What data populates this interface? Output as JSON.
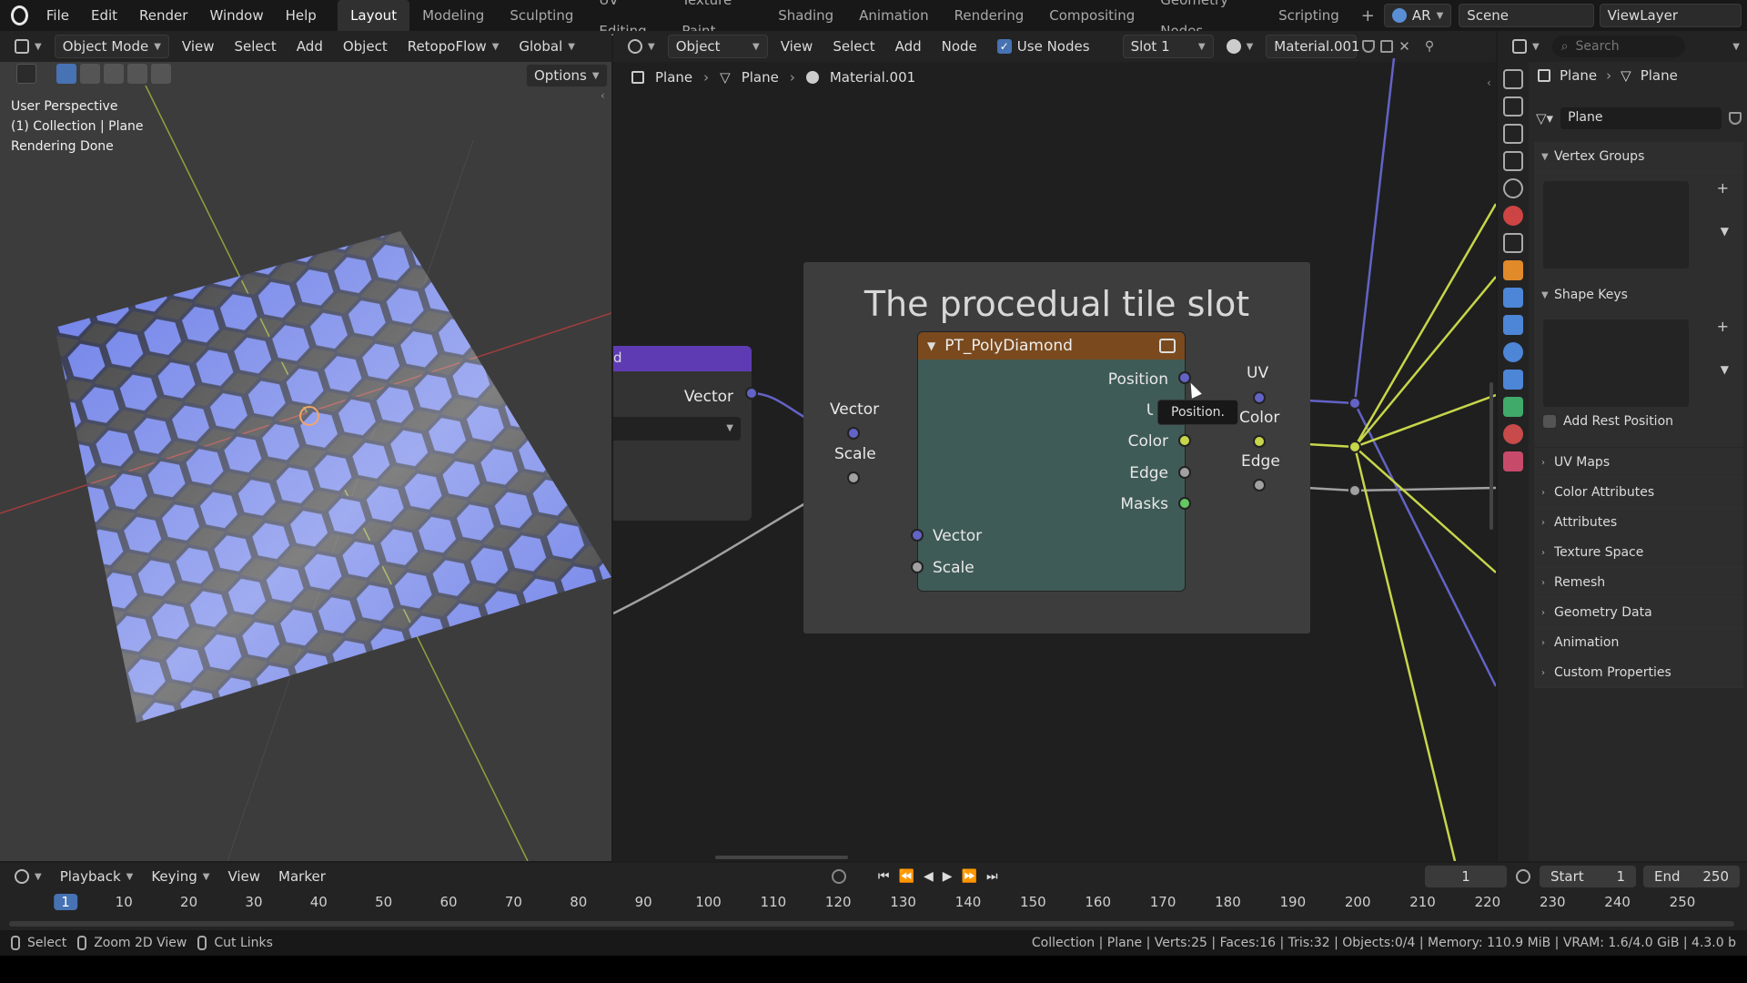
{
  "menu": {
    "file": "File",
    "edit": "Edit",
    "render": "Render",
    "window": "Window",
    "help": "Help"
  },
  "workspaces": [
    "Layout",
    "Modeling",
    "Sculpting",
    "UV Editing",
    "Texture Paint",
    "Shading",
    "Animation",
    "Rendering",
    "Compositing",
    "Geometry Nodes",
    "Scripting"
  ],
  "topright": {
    "engine": "AR",
    "scene": "Scene",
    "viewlayer": "ViewLayer"
  },
  "viewport": {
    "mode": "Object Mode",
    "view": "View",
    "select": "Select",
    "add": "Add",
    "object": "Object",
    "retopo": "RetopoFlow",
    "transform": "Global",
    "options": "Options",
    "info": [
      "User Perspective",
      "(1) Collection | Plane",
      "Rendering Done"
    ]
  },
  "node_header": {
    "object": "Object",
    "view": "View",
    "select": "Select",
    "add": "Add",
    "node": "Node",
    "use_nodes": "Use Nodes",
    "slot": "Slot 1",
    "material": "Material.001"
  },
  "breadcrumb": [
    "Plane",
    "Plane",
    "Material.001"
  ],
  "frame": {
    "title": "The procedual tile slot"
  },
  "node": {
    "name": "PT_PolyDiamond",
    "outputs": [
      "Position",
      "UV",
      "Color",
      "Edge",
      "Masks"
    ],
    "inputs": [
      "Vector",
      "Scale"
    ]
  },
  "reroutes": {
    "vector": "Vector",
    "scale": "Scale",
    "uv": "UV",
    "color": "Color",
    "edge": "Edge"
  },
  "left_node": {
    "vector": "Vector"
  },
  "tooltip": "Position.",
  "props": {
    "search": "Search",
    "object": "Plane",
    "mesh": "Plane",
    "data_name": "Plane",
    "vertex_groups": "Vertex Groups",
    "shape_keys": "Shape Keys",
    "add_rest": "Add Rest Position",
    "panels": [
      "UV Maps",
      "Color Attributes",
      "Attributes",
      "Texture Space",
      "Remesh",
      "Geometry Data",
      "Animation",
      "Custom Properties"
    ]
  },
  "timeline": {
    "playback": "Playback",
    "keying": "Keying",
    "view": "View",
    "marker": "Marker",
    "current": "1",
    "start_label": "Start",
    "start": "1",
    "end_label": "End",
    "end": "250",
    "ticks": [
      "1",
      "10",
      "20",
      "30",
      "40",
      "50",
      "60",
      "70",
      "80",
      "90",
      "100",
      "110",
      "120",
      "130",
      "140",
      "150",
      "160",
      "170",
      "180",
      "190",
      "200",
      "210",
      "220",
      "230",
      "240",
      "250"
    ]
  },
  "status": {
    "select": "Select",
    "zoom": "Zoom 2D View",
    "cut": "Cut Links",
    "info": "Collection | Plane | Verts:25 | Faces:16 | Tris:32 | Objects:0/4 | Memory: 110.9 MiB | VRAM: 1.6/4.0 GiB | 4.3.0 b"
  },
  "colors": {
    "vector_socket": "#6363c7",
    "yellow_socket": "#c7d64a",
    "gray_socket": "#a1a1a1",
    "green_socket": "#63c763",
    "node_header": "#7a4a1e",
    "node_body": "#3f5b57",
    "frame_bg": "#3d3d3d"
  }
}
